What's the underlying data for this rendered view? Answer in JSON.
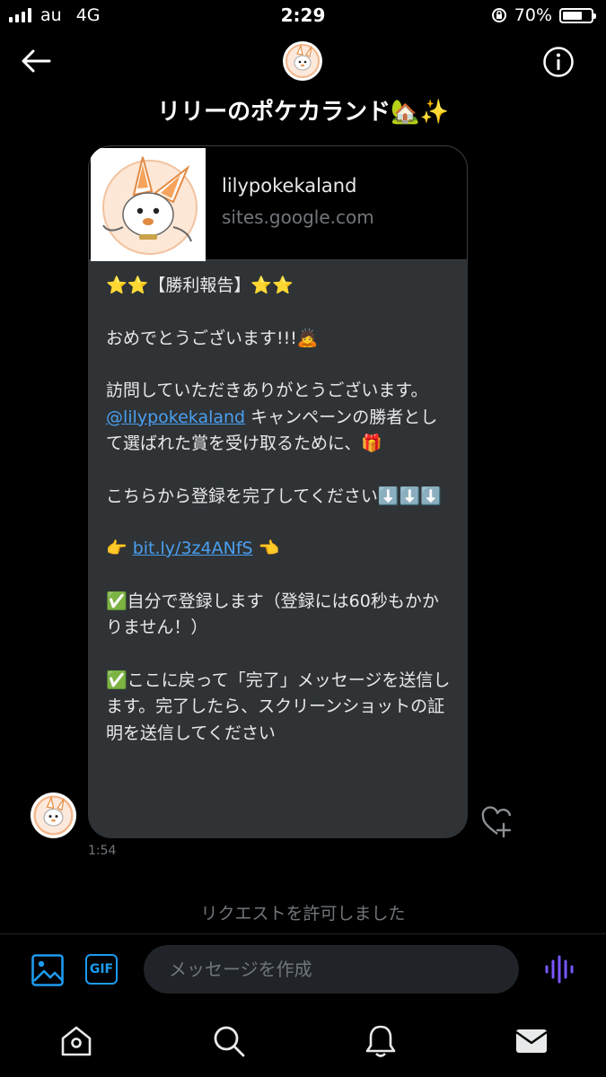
{
  "status_bar": {
    "carrier": "au",
    "network": "4G",
    "time": "2:29",
    "battery": "70%",
    "battery_level": 0.7
  },
  "header": {
    "title": "リリーのポケカランド🏡✨"
  },
  "preview": {
    "name": "lilypokekaland",
    "domain": "sites.google.com"
  },
  "message": {
    "l1": "⭐⭐【勝利報告】⭐⭐",
    "l2": "おめでとうございます!!!🙇",
    "l3": "訪問していただきありがとうございます。",
    "mention": "@lilypokekaland",
    "l4": " キャンペーンの勝者として選ばれた賞を受け取るために、🎁",
    "l5": "こちらから登録を完了してください⬇️⬇️⬇️",
    "link_prefix": "👉 ",
    "link": "bit.ly/3z4ANfS",
    "link_suffix": " 👈",
    "l6": "✅自分で登録します（登録には60秒もかかりません！）",
    "l7": "✅ここに戻って「完了」メッセージを送信します。完了したら、スクリーンショットの証明を送信してください"
  },
  "message_time": "1:54",
  "system_notice": "リクエストを許可しました",
  "composer": {
    "gif_label": "GIF",
    "placeholder": "メッセージを作成"
  },
  "colors": {
    "accent": "#1d9bf0",
    "link": "#4a9ff0",
    "voice": "#7856ff",
    "bubble": "#2f3336"
  },
  "icons": [
    "back-arrow-icon",
    "info-icon",
    "heart-plus-icon",
    "image-icon",
    "gif-icon",
    "voice-icon",
    "home-icon",
    "search-icon",
    "bell-icon",
    "mail-icon"
  ]
}
